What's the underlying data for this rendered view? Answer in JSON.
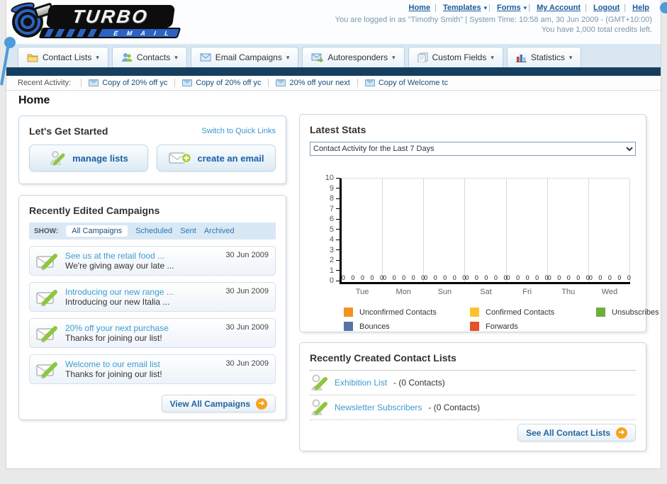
{
  "chart_data": {
    "type": "bar",
    "title": "Contact Activity for the Last 7 Days",
    "categories": [
      "Tue",
      "Mon",
      "Sun",
      "Sat",
      "Fri",
      "Thu",
      "Wed"
    ],
    "series": [
      {
        "name": "Unconfirmed Contacts",
        "color": "#f6921e",
        "values": [
          0,
          0,
          0,
          0,
          0,
          0,
          0
        ]
      },
      {
        "name": "Confirmed Contacts",
        "color": "#fdc22f",
        "values": [
          0,
          0,
          0,
          0,
          0,
          0,
          0
        ]
      },
      {
        "name": "Unsubscribes",
        "color": "#6fae3c",
        "values": [
          0,
          0,
          0,
          0,
          0,
          0,
          0
        ]
      },
      {
        "name": "Bounces",
        "color": "#5573a7",
        "values": [
          0,
          0,
          0,
          0,
          0,
          0,
          0
        ]
      },
      {
        "name": "Forwards",
        "color": "#e8502a",
        "values": [
          0,
          0,
          0,
          0,
          0,
          0,
          0
        ]
      }
    ],
    "ylim": [
      0,
      10
    ],
    "yticks": [
      "10",
      "9",
      "8",
      "7",
      "6",
      "5",
      "4",
      "3",
      "2",
      "1",
      "0"
    ],
    "value_label_row": "0 0 0 0 0",
    "grid": "vertical day separators",
    "legend_position": "bottom"
  },
  "header": {
    "logo_line1": "TURBO",
    "logo_line2": "E M A I L",
    "nav": {
      "home": "Home",
      "templates": "Templates",
      "forms": "Forms",
      "my_account": "My Account",
      "logout": "Logout",
      "help": "Help"
    },
    "login_info": "You are logged in as \"Timothy Smith\" | System Time: 10:58 am, 30 Jun 2009 - (GMT+10:00)",
    "credits_info": "You have 1,000 total credits left."
  },
  "tabs": [
    {
      "label": "Contact Lists"
    },
    {
      "label": "Contacts"
    },
    {
      "label": "Email Campaigns"
    },
    {
      "label": "Autoresponders"
    },
    {
      "label": "Custom Fields"
    },
    {
      "label": "Statistics"
    }
  ],
  "recent_activity": {
    "label": "Recent Activity:",
    "items": [
      {
        "text": "Copy of 20% off yc"
      },
      {
        "text": "Copy of 20% off yc"
      },
      {
        "text": "20% off your next"
      },
      {
        "text": "Copy of Welcome tc"
      }
    ]
  },
  "page_title": "Home",
  "get_started": {
    "title": "Let's Get Started",
    "switch_link": "Switch to Quick Links",
    "manage_lists_button": "manage lists",
    "create_email_button": "create an email"
  },
  "campaigns_panel": {
    "title": "Recently Edited Campaigns",
    "show_label": "SHOW:",
    "filters": [
      {
        "label": "All Campaigns"
      },
      {
        "label": "Scheduled"
      },
      {
        "label": "Sent"
      },
      {
        "label": "Archived"
      }
    ],
    "items": [
      {
        "title": "See us at the retail food ...",
        "subtitle": "We're giving away our late ...",
        "date": "30 Jun 2009"
      },
      {
        "title": "Introducing our new range ...",
        "subtitle": "Introducing our new Italia ...",
        "date": "30 Jun 2009"
      },
      {
        "title": "20% off your next purchase",
        "subtitle": "Thanks for joining our list!",
        "date": "30 Jun 2009"
      },
      {
        "title": "Welcome to our email list",
        "subtitle": "Thanks for joining our list!",
        "date": "30 Jun 2009"
      }
    ],
    "view_all_button": "View All Campaigns"
  },
  "stats_panel": {
    "title": "Latest Stats",
    "dropdown_value": "Contact Activity for the Last 7 Days"
  },
  "contact_lists_panel": {
    "title": "Recently Created Contact Lists",
    "items": [
      {
        "link": "Exhibition List",
        "suffix": " - (0 Contacts)"
      },
      {
        "link": "Newsletter Subscribers",
        "suffix": " - (0 Contacts)"
      }
    ],
    "see_all_button": "See All Contact Lists"
  },
  "colors": {
    "navy_bar": "#163f5f",
    "accent_orange": "#f5a31f",
    "header_link_blue": "#1b5a9b",
    "item_link_blue": "#3e9bd3"
  }
}
